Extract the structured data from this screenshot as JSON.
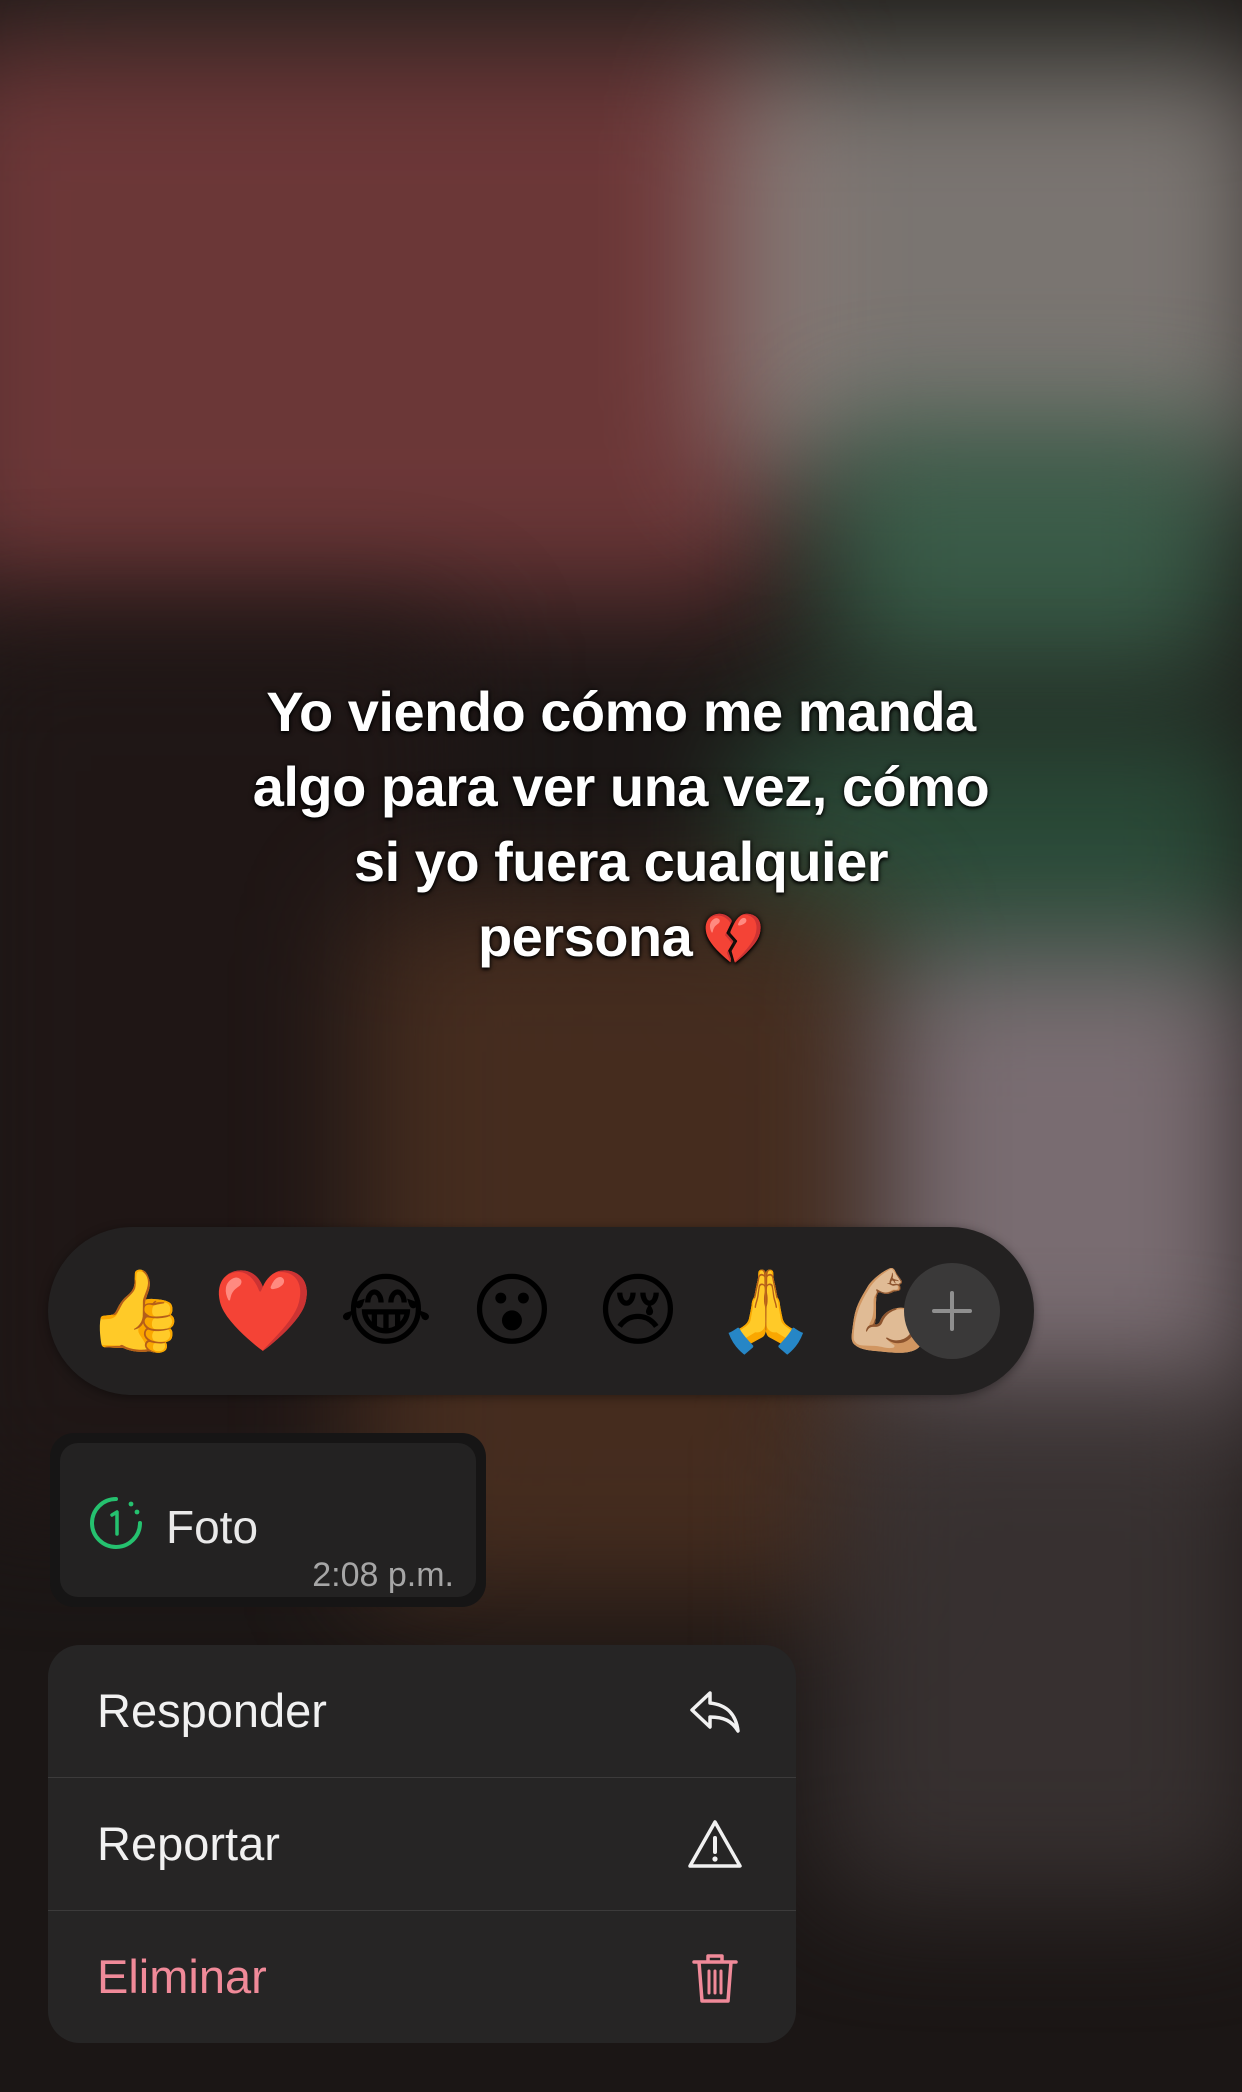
{
  "caption": {
    "text": "Yo viendo cómo me manda algo para ver una vez, cómo si yo fuera cualquier persona",
    "emoji": "💔",
    "line1": "Yo viendo cómo me manda",
    "line2": "algo para ver una vez, cómo",
    "line3": "si yo fuera cualquier",
    "line4": "persona"
  },
  "reactions": {
    "items": [
      "👍",
      "❤️",
      "😂",
      "😮",
      "😢",
      "🙏",
      "💪🏼"
    ],
    "more_icon": "plus-icon"
  },
  "message": {
    "icon": "view-once-timer-icon",
    "label": "Foto",
    "time": "2:08 p.m."
  },
  "menu": {
    "items": [
      {
        "label": "Responder",
        "icon": "reply-arrow-icon"
      },
      {
        "label": "Reportar",
        "icon": "warning-triangle-icon"
      },
      {
        "label": "Eliminar",
        "icon": "trash-icon",
        "color": "#f08a99"
      }
    ]
  },
  "colors": {
    "menu_bg": "#262525",
    "reaction_bar_bg": "#232121",
    "bubble_bg": "#232222",
    "view_once_accent": "#25c16f",
    "danger": "#f08a99"
  }
}
